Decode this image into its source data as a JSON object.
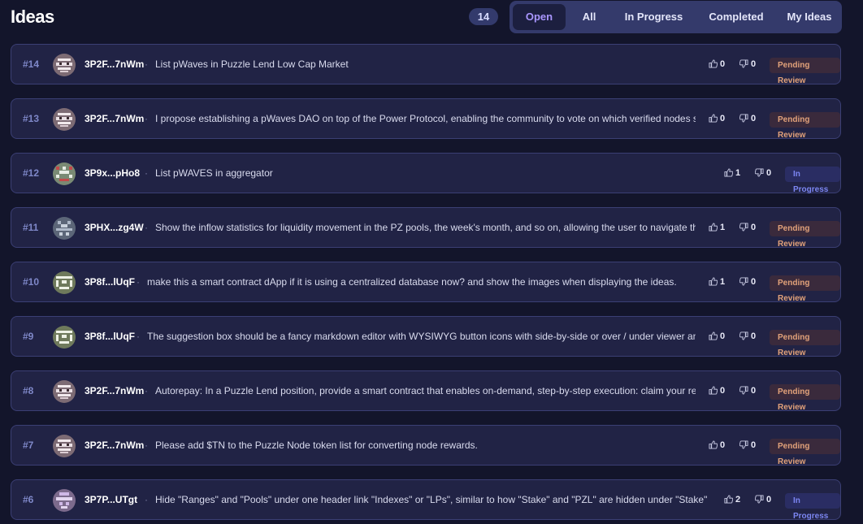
{
  "header": {
    "title": "Ideas",
    "count": "14",
    "tabs": [
      {
        "label": "Open",
        "active": true
      },
      {
        "label": "All",
        "active": false
      },
      {
        "label": "In Progress",
        "active": false
      },
      {
        "label": "Completed",
        "active": false
      },
      {
        "label": "My Ideas",
        "active": false
      }
    ]
  },
  "colors": {
    "background": "#13152b",
    "row": "#212345",
    "accent": "#a996ff",
    "pending": "#e2a27a",
    "in_progress": "#7c86f2"
  },
  "ideas": [
    {
      "number": "#14",
      "author": "3P2F...7nWm",
      "text": "List pWaves in Puzzle Lend Low Cap Market",
      "up": "0",
      "down": "0",
      "status": "Pending Review"
    },
    {
      "number": "#13",
      "author": "3P2F...7nWm",
      "text": "I propose establishing a pWaves DAO on top of the Power Protocol, enabling the community to vote on which verified nodes sh...",
      "up": "0",
      "down": "0",
      "status": "Pending Review"
    },
    {
      "number": "#12",
      "author": "3P9x...pHo8",
      "text": "List pWAVES in aggregator",
      "up": "1",
      "down": "0",
      "status": "In Progress"
    },
    {
      "number": "#11",
      "author": "3PHX...zg4W",
      "text": "Show the inflow statistics for liquidity movement in the PZ pools, the week's month, and so on, allowing the user to navigate th...",
      "up": "1",
      "down": "0",
      "status": "Pending Review"
    },
    {
      "number": "#10",
      "author": "3P8f...lUqF",
      "text": "make this a smart contract dApp if it is using a centralized database now? and show the images when displaying the ideas.",
      "up": "1",
      "down": "0",
      "status": "Pending Review"
    },
    {
      "number": "#9",
      "author": "3P8f...lUqF",
      "text": "The suggestion box should be a fancy markdown editor with WYSIWYG button icons with side-by-side or over / under viewer and ...",
      "up": "0",
      "down": "0",
      "status": "Pending Review"
    },
    {
      "number": "#8",
      "author": "3P2F...7nWm",
      "text": "Autorepay: In a Puzzle Lend position, provide a smart contract that enables on-demand, step-by-step execution: claim your rew...",
      "up": "0",
      "down": "0",
      "status": "Pending Review"
    },
    {
      "number": "#7",
      "author": "3P2F...7nWm",
      "text": "Please add $TN to the Puzzle Node token list for converting node rewards.",
      "up": "0",
      "down": "0",
      "status": "Pending Review"
    },
    {
      "number": "#6",
      "author": "3P7P...UTgt",
      "text": "Hide \"Ranges\" and \"Pools\" under one header link \"Indexes\" or \"LPs\", similar to how \"Stake\" and \"PZL\" are hidden under \"Stake\"",
      "up": "2",
      "down": "0",
      "status": "In Progress"
    }
  ]
}
